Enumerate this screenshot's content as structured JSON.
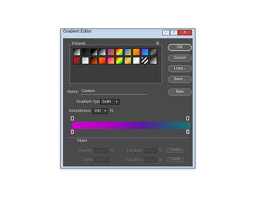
{
  "window": {
    "title": "Gradient Editor",
    "minimize": "–",
    "maximize": "□",
    "close": "✕"
  },
  "presets": {
    "label": "Presets",
    "menu_icon": "gear-icon",
    "swatches": [
      "linear-gradient(135deg,#000,#fff)",
      "linear-gradient(135deg,#000,#ffffff00)",
      "linear-gradient(135deg,#000 0%,#000 40%,#fff 100%)",
      "linear-gradient(135deg,#000,#fff)",
      "linear-gradient(135deg,#6a3fbf,#ff6a00)",
      "linear-gradient(135deg,#ff0000,#ffe600,#00aaff)",
      "linear-gradient(135deg,#1a6fff,#ffcc00)",
      "linear-gradient(135deg,#ffb000,#ff5a00)",
      "linear-gradient(135deg,#7a2bd8,#00c3ff)",
      "linear-gradient(135deg,#111,#777,#111)",
      "linear-gradient(135deg,#ff0000,#ffffff00)",
      "linear-gradient(135deg,#b5b5b5,#ffffff)",
      "linear-gradient(135deg,#000,#ff6e00)",
      "linear-gradient(135deg,#ff9a00,#ff0000)",
      "linear-gradient(135deg,#ff00cc,#ffd000)",
      "linear-gradient(135deg,#ff0000,#ffa500,#ffff00,#00ff00,#0000ff)",
      "linear-gradient(135deg,#c47f3a,#f0d070,#c47f3a)",
      "linear-gradient(135deg,#ccc,#fff,#ccc)",
      "repeating-linear-gradient(135deg,#fff 0,#fff 2px,#000 2px,#000 4px)",
      "linear-gradient(135deg,#000,#fff)"
    ]
  },
  "buttons": {
    "ok": "OK",
    "cancel": "Cancel",
    "load": "Load...",
    "save": "Save...",
    "new": "New"
  },
  "name": {
    "label": "Name:",
    "value": "Custom"
  },
  "gradient_type": {
    "label": "Gradient Type:",
    "value": "Solid"
  },
  "smoothness": {
    "label": "Smoothness:",
    "value": "100",
    "unit": "%"
  },
  "gradient_bar": {
    "stops_color": [
      "#cc00cc",
      "#1e7270"
    ],
    "stops_opacity": [
      100,
      100
    ]
  },
  "stops": {
    "label": "Stops",
    "opacity_label": "Opacity:",
    "color_label": "Color:",
    "location_label": "Location:",
    "percent": "%",
    "delete": "Delete"
  }
}
